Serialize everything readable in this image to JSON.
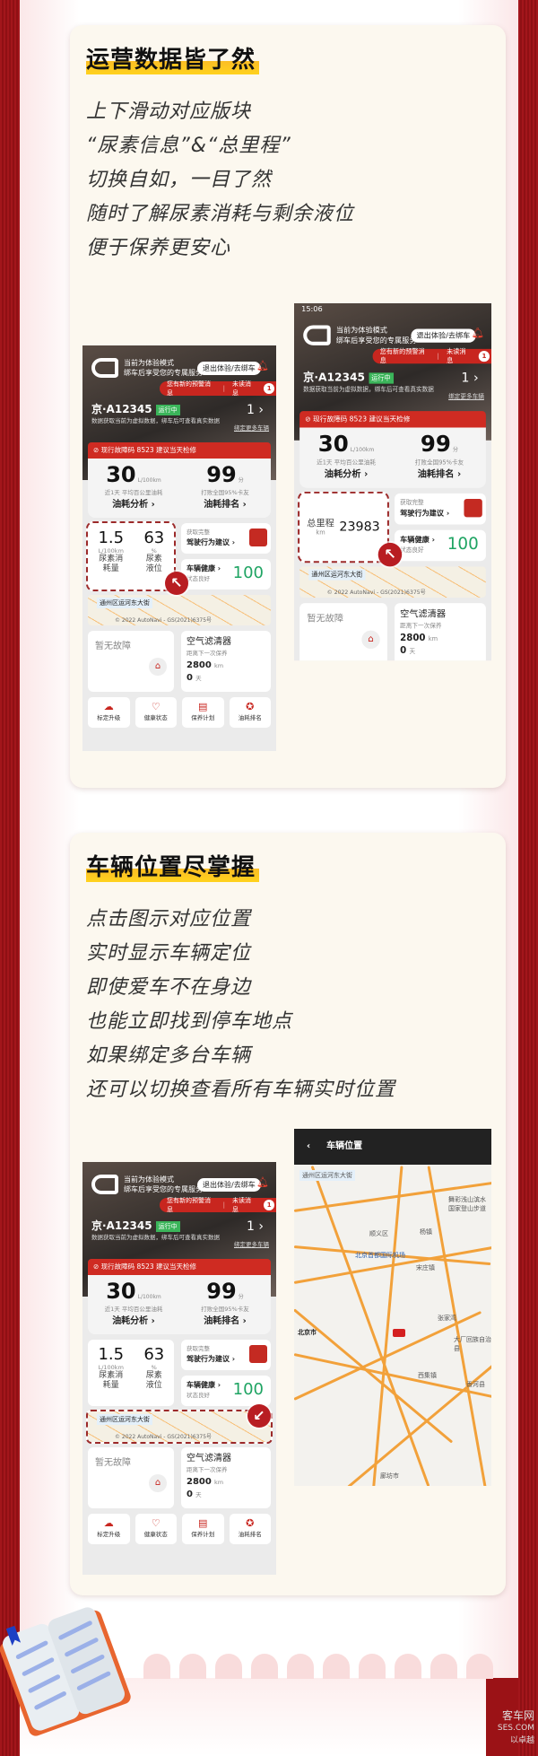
{
  "section1": {
    "title": "运营数据皆了然",
    "lines": [
      "上下滑动对应版块",
      "“尿素信息”&“总里程”",
      "切换自如，一目了然",
      "随时了解尿素消耗与剩余液位",
      "便于保养更安心"
    ]
  },
  "section2": {
    "title": "车辆位置尽掌握",
    "lines": [
      "点击图示对应位置",
      "实时显示车辆定位",
      "即使爱车不在身边",
      "也能立即找到停车地点",
      "如果绑定多台车辆",
      "还可以切换查看所有车辆实时位置"
    ]
  },
  "app": {
    "status_time": "15:06",
    "mode_line1": "当前为体验模式",
    "mode_line2": "绑车后享受您的专属服务",
    "exit_button": "退出体验/去绑车",
    "alert_text": "您有新的预警消息",
    "unread_label": "未读消息",
    "unread_count": "1",
    "plate": "京·A12345",
    "running_badge": "运行中",
    "virtual_note": "数据获取当前为虚拟数据，绑车后可查看真实数据",
    "vehicle_count": "1 ›",
    "bind_more": "绑定更多车辆",
    "fault_bar": "现行故障码 8523 建议当天检修",
    "fuel_value": "30",
    "fuel_unit": "L/100km",
    "fuel_caption": "近1天 平均百公里油耗",
    "fuel_link": "油耗分析 ›",
    "rank_value": "99",
    "rank_unit": "分",
    "rank_caption": "打败全国95%卡友",
    "rank_link": "油耗排名 ›",
    "urea_consumption": "1.5",
    "urea_consumption_unit": "L/100km",
    "urea_consumption_label": "尿素消耗量",
    "urea_level": "63",
    "urea_level_unit": "%",
    "urea_level_label": "尿素液位",
    "mileage_label": "总里程",
    "mileage_unit": "km",
    "mileage_value": "23983",
    "drive_small": "获取完整",
    "drive_link": "驾驶行为建议 ›",
    "health_link": "车辆健康 ›",
    "health_status": "状态良好",
    "health_score": "100",
    "map_label": "通州区运河东大街",
    "map_copyright": "© 2022 AutoNavi - GS(2021)6375号",
    "no_fault": "暂无故障",
    "air_filter": "空气滤清器",
    "next_service": "距离下一次保养",
    "km_left": "2800",
    "km_unit": "km",
    "days_left": "0",
    "days_unit": "天",
    "nav": [
      "标定升级",
      "健康状态",
      "保养计划",
      "油耗排名"
    ]
  },
  "map_screen": {
    "title": "车辆位置",
    "labels": [
      "通州区运河东大街",
      "北京首都国际机场",
      "北京市",
      "舞彩浅山滨水国家登山步道",
      "顺义区",
      "杨镇",
      "宋庄镇",
      "张家湾",
      "大厂回族自治县",
      "西集镇",
      "香河县",
      "廊坊市"
    ]
  },
  "watermark": [
    "客车网",
    "SES.COM",
    "以卓越"
  ],
  "colors": {
    "brand_red": "#c8261f",
    "highlight_yellow": "#fbbd24",
    "health_green": "#1fa463"
  }
}
